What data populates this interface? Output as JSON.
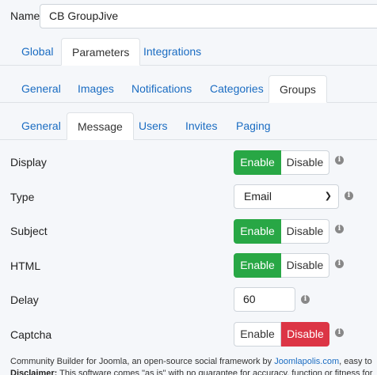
{
  "name_field": {
    "label": "Name",
    "value": "CB GroupJive"
  },
  "main_tabs": [
    "Global",
    "Parameters",
    "Integrations"
  ],
  "param_tabs": [
    "General",
    "Images",
    "Notifications",
    "Categories",
    "Groups"
  ],
  "group_tabs": [
    "General",
    "Message",
    "Users",
    "Invites",
    "Paging"
  ],
  "fields": {
    "display": {
      "label": "Display",
      "enable": "Enable",
      "disable": "Disable",
      "state": "enabled"
    },
    "type": {
      "label": "Type",
      "value": "Email"
    },
    "subject": {
      "label": "Subject",
      "enable": "Enable",
      "disable": "Disable",
      "state": "enabled"
    },
    "html": {
      "label": "HTML",
      "enable": "Enable",
      "disable": "Disable",
      "state": "enabled"
    },
    "delay": {
      "label": "Delay",
      "value": "60"
    },
    "captcha": {
      "label": "Captcha",
      "enable": "Enable",
      "disable": "Disable",
      "state": "disabled"
    }
  },
  "footer": {
    "line1_prefix": "Community Builder for Joomla, an open-source social framework by ",
    "line1_link": "Joomlapolis.com",
    "line1_suffix": ", easy to",
    "line2_bold": "Disclaimer:",
    "line2_text": " This software comes \"as is\" with no guarantee for accuracy, function or fitness for"
  },
  "colors": {
    "link": "#1a6cc2",
    "enable_active": "#28a745",
    "disable_active": "#dc3545"
  }
}
